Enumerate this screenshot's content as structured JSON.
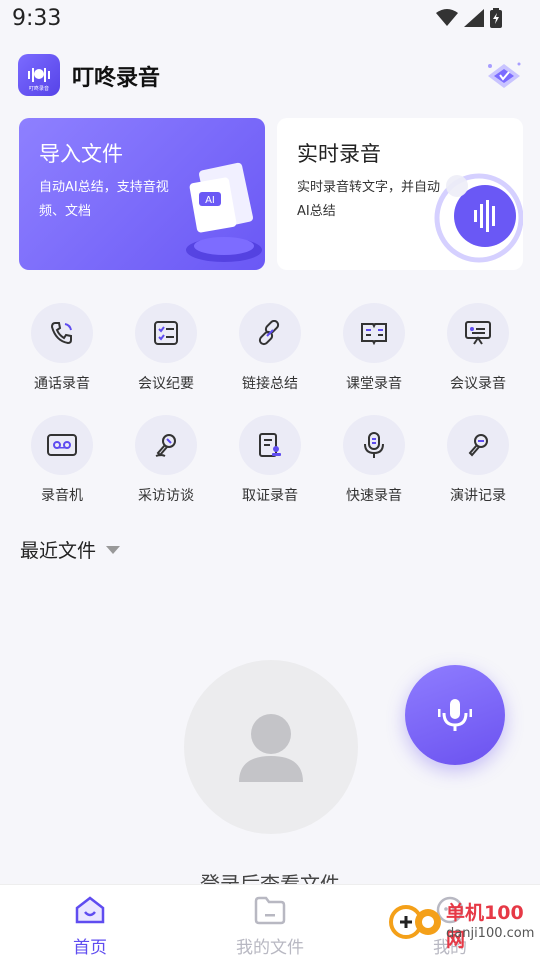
{
  "status_bar": {
    "time": "9:33",
    "icons": [
      "wifi-icon",
      "signal-icon",
      "battery-icon"
    ]
  },
  "header": {
    "app_name": "叮咚录音",
    "logo_caption": "叮咚录音",
    "vip_icon": "vip-badge-icon"
  },
  "cards": {
    "import": {
      "title": "导入文件",
      "desc": "自动AI总结，支持音视频、文档",
      "art_label": "AI"
    },
    "live": {
      "title": "实时录音",
      "desc": "实时录音转文字，并自动AI总结"
    }
  },
  "tools": [
    {
      "label": "通话录音",
      "icon": "phone-call-icon"
    },
    {
      "label": "会议纪要",
      "icon": "checklist-icon"
    },
    {
      "label": "链接总结",
      "icon": "link-icon"
    },
    {
      "label": "课堂录音",
      "icon": "book-icon"
    },
    {
      "label": "会议录音",
      "icon": "presentation-icon"
    },
    {
      "label": "录音机",
      "icon": "cassette-icon"
    },
    {
      "label": "采访访谈",
      "icon": "interview-mic-icon"
    },
    {
      "label": "取证录音",
      "icon": "document-stamp-icon"
    },
    {
      "label": "快速录音",
      "icon": "microphone-icon"
    },
    {
      "label": "演讲记录",
      "icon": "speech-mic-icon"
    }
  ],
  "recent": {
    "label": "最近文件"
  },
  "empty_state": {
    "hint": "登录后查看文件"
  },
  "tabs": [
    {
      "label": "首页",
      "icon": "home-icon",
      "active": true
    },
    {
      "label": "我的文件",
      "icon": "folder-icon",
      "active": false
    },
    {
      "label": "我的",
      "icon": "profile-icon",
      "active": false
    }
  ],
  "watermark": {
    "text": "单机100网",
    "url": "danji100.com"
  },
  "colors": {
    "accent": "#5f4cf0",
    "card_gradient_start": "#8e80ff",
    "card_gradient_end": "#6a58f5"
  }
}
